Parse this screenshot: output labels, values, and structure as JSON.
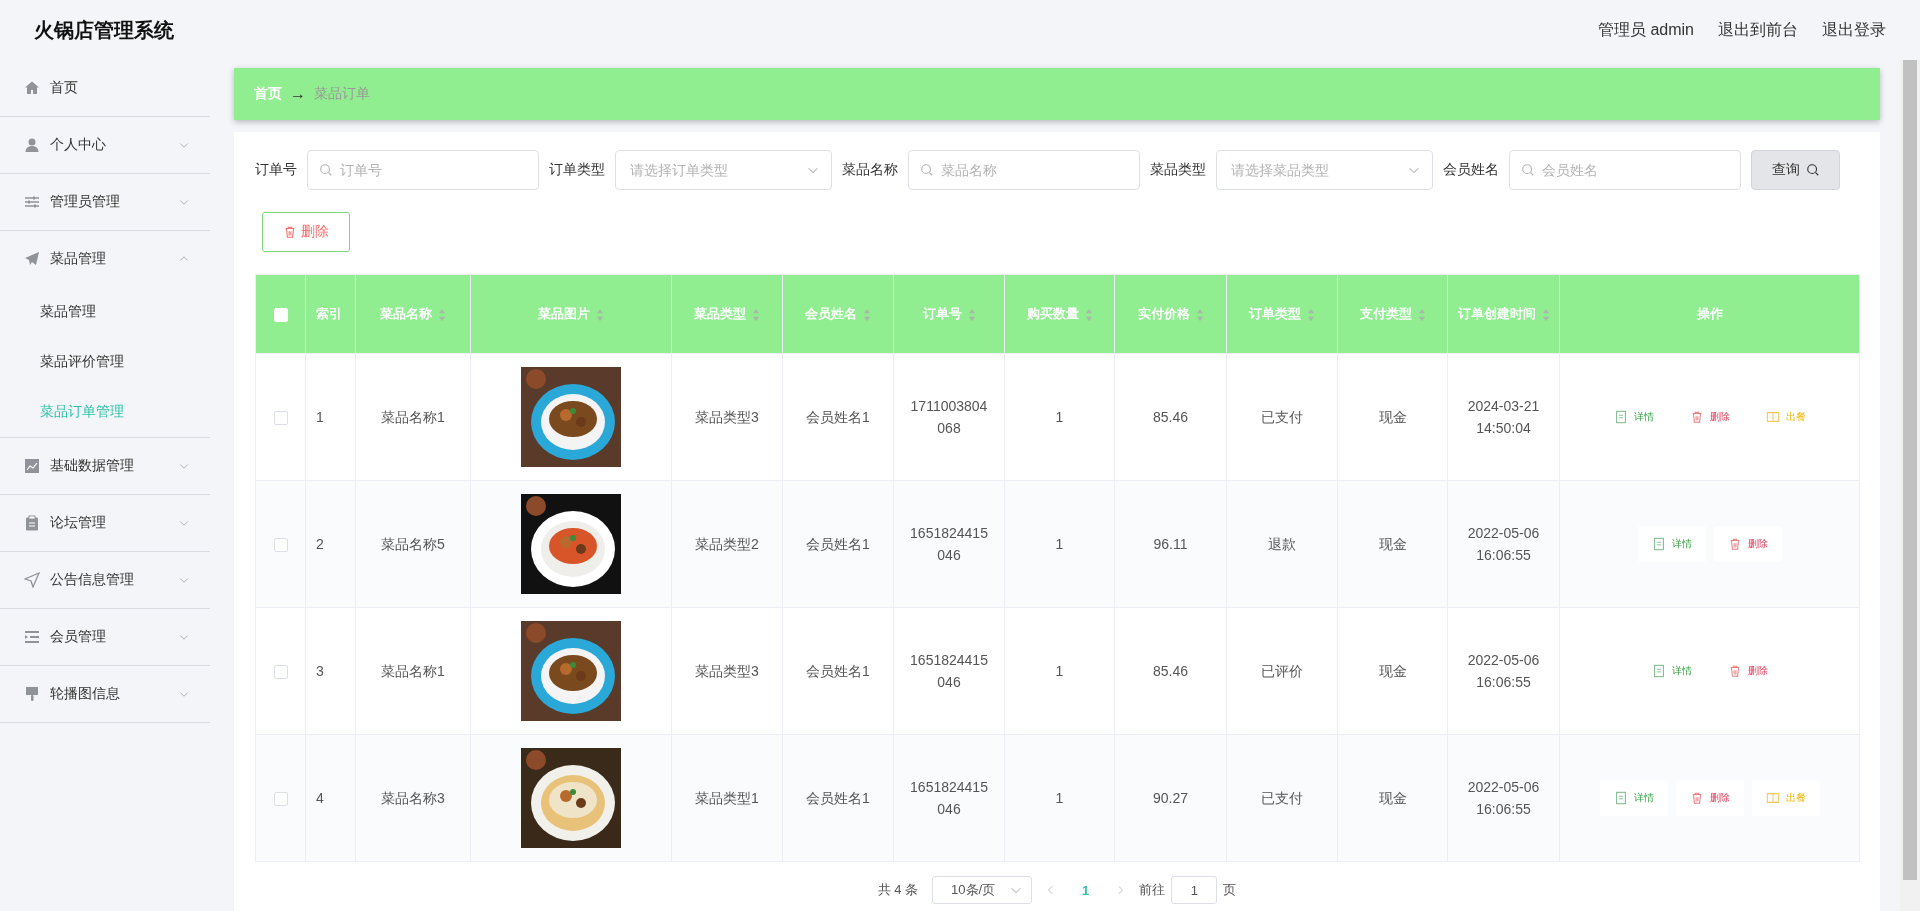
{
  "app": {
    "title": "火锅店管理系统",
    "links": [
      "管理员 admin",
      "退出到前台",
      "退出登录"
    ]
  },
  "sidebar": {
    "items": [
      {
        "label": "首页",
        "selected": false
      },
      {
        "label": "个人中心",
        "expanded": false
      },
      {
        "label": "管理员管理",
        "expanded": false
      },
      {
        "label": "菜品管理",
        "expanded": true,
        "children": [
          {
            "label": "菜品管理",
            "selected": false
          },
          {
            "label": "菜品评价管理",
            "selected": false
          },
          {
            "label": "菜品订单管理",
            "selected": true
          }
        ]
      },
      {
        "label": "基础数据管理",
        "expanded": false
      },
      {
        "label": "论坛管理",
        "expanded": false
      },
      {
        "label": "公告信息管理",
        "expanded": false
      },
      {
        "label": "会员管理",
        "expanded": false
      },
      {
        "label": "轮播图信息",
        "expanded": false
      }
    ]
  },
  "breadcrumb": {
    "home": "首页",
    "separator": "→",
    "current": "菜品订单"
  },
  "filters": [
    {
      "label": "订单号",
      "kind": "input",
      "placeholder": "订单号"
    },
    {
      "label": "订单类型",
      "kind": "select",
      "placeholder": "请选择订单类型"
    },
    {
      "label": "菜品名称",
      "kind": "input",
      "placeholder": "菜品名称"
    },
    {
      "label": "菜品类型",
      "kind": "select",
      "placeholder": "请选择菜品类型"
    },
    {
      "label": "会员姓名",
      "kind": "input",
      "placeholder": "会员姓名"
    }
  ],
  "search_button": "查询",
  "delete_button": "删除",
  "table": {
    "columns": [
      {
        "kind": "check",
        "checked": false
      },
      {
        "kind": "text",
        "label": "索引",
        "sortable": false
      },
      {
        "kind": "text",
        "label": "菜品名称",
        "sortable": true
      },
      {
        "label": "菜品图片",
        "sortable": true
      },
      {
        "kind": "text",
        "label": "菜品类型",
        "sortable": true
      },
      {
        "kind": "text",
        "label": "会员姓名",
        "sortable": true
      },
      {
        "kind": "text",
        "label": "订单号",
        "sortable": true
      },
      {
        "kind": "text",
        "label": "购买数量",
        "sortable": true
      },
      {
        "kind": "text",
        "label": "实付价格",
        "sortable": true
      },
      {
        "kind": "text",
        "label": "订单类型",
        "sortable": true
      },
      {
        "kind": "text",
        "label": "支付类型",
        "sortable": true
      },
      {
        "kind": "text",
        "label": "订单创建时间",
        "sortable": true
      },
      {
        "kind": "actions",
        "label": "操作",
        "sortable": false
      }
    ],
    "rows": [
      {
        "cells": [
          {
            "kind": "check",
            "checked": false
          },
          "1",
          "菜品名称1",
          {
            "kind": "picture"
          },
          "菜品类型3",
          "会员姓名1",
          "1711003804068",
          "1",
          "85.46",
          "已支付",
          "现金",
          "2024-03-21 14:50:04"
        ],
        "actions": [
          {
            "kind": "detail",
            "label": "详情"
          },
          {
            "kind": "delete",
            "label": "删除"
          },
          {
            "kind": "serve",
            "label": "出餐"
          }
        ]
      },
      {
        "cells": [
          {
            "kind": "check",
            "checked": false
          },
          "2",
          "菜品名称5",
          {
            "kind": "picture"
          },
          "菜品类型2",
          "会员姓名1",
          "1651824415046",
          "1",
          "96.11",
          "退款",
          "现金",
          "2022-05-06 16:06:55"
        ],
        "actions": [
          {
            "kind": "detail",
            "label": "详情"
          },
          {
            "kind": "delete",
            "label": "删除"
          }
        ]
      },
      {
        "cells": [
          {
            "kind": "check",
            "checked": false
          },
          "3",
          "菜品名称1",
          {
            "kind": "picture"
          },
          "菜品类型3",
          "会员姓名1",
          "1651824415046",
          "1",
          "85.46",
          "已评价",
          "现金",
          "2022-05-06 16:06:55"
        ],
        "actions": [
          {
            "kind": "detail",
            "label": "详情"
          },
          {
            "kind": "delete",
            "label": "删除"
          }
        ]
      },
      {
        "cells": [
          {
            "kind": "check",
            "checked": false
          },
          "4",
          "菜品名称3",
          {
            "kind": "picture"
          },
          "菜品类型1",
          "会员姓名1",
          "1651824415046",
          "1",
          "90.27",
          "已支付",
          "现金",
          "2022-05-06 16:06:55"
        ],
        "actions": [
          {
            "kind": "detail",
            "label": "详情"
          },
          {
            "kind": "delete",
            "label": "删除"
          },
          {
            "kind": "serve",
            "label": "出餐"
          }
        ]
      }
    ]
  },
  "pagination": {
    "total": "共 4 条",
    "page_size": "10条/页",
    "pages": [
      {
        "label": "1",
        "selected": true
      }
    ],
    "goto_label": "前往",
    "goto_value": "1",
    "goto_suffix": "页"
  }
}
